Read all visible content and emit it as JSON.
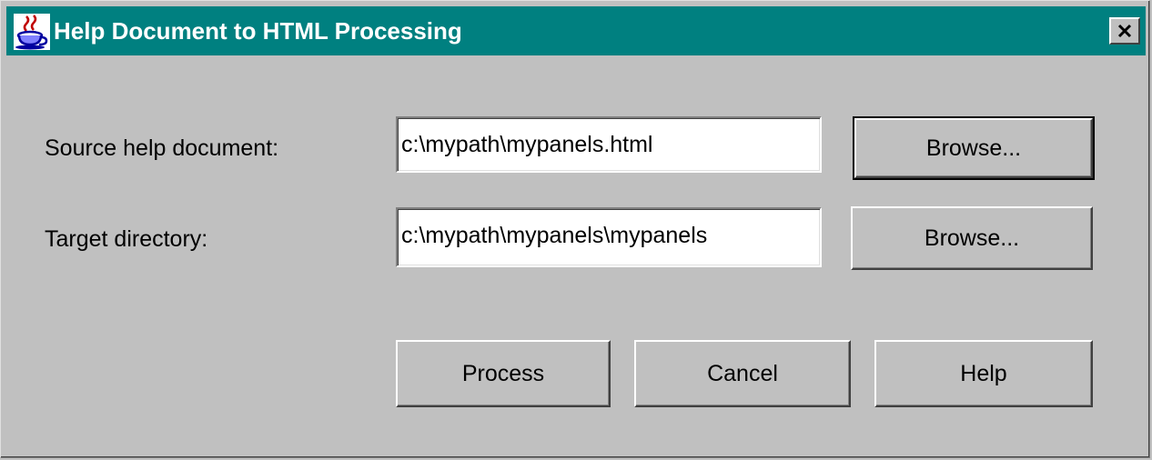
{
  "window": {
    "title": "Help Document to HTML Processing",
    "icon": "java-coffee-cup-icon",
    "close_icon": "close-icon",
    "title_color": "#008080"
  },
  "form": {
    "source": {
      "label": "Source help document:",
      "value": "c:\\mypath\\mypanels.html",
      "browse_label": "Browse..."
    },
    "target": {
      "label": "Target directory:",
      "value": "c:\\mypath\\mypanels\\mypanels",
      "browse_label": "Browse..."
    }
  },
  "actions": {
    "process_label": "Process",
    "cancel_label": "Cancel",
    "help_label": "Help"
  }
}
